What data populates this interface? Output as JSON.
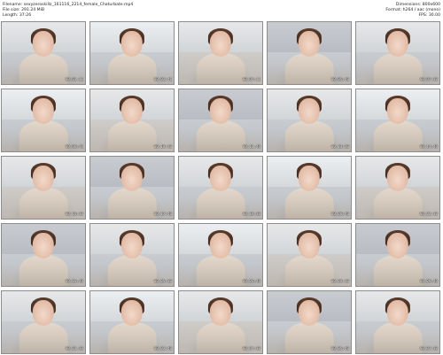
{
  "header": {
    "filename_label": "Filename:",
    "filename": "sexyzeroskillz_161116_2214_female_Chaturbate.mp4",
    "filesize_label": "File size:",
    "filesize": "291.24 MiB",
    "length_label": "Length:",
    "length": "37:26",
    "dimensions_label": "Dimensions:",
    "dimensions": "800x600",
    "format_label": "Format:",
    "format": "h264 / aac (mono)",
    "fps_label": "FPS:",
    "fps": "30.00"
  },
  "thumbnails": [
    {
      "timestamp": "00:01:11"
    },
    {
      "timestamp": "00:02:41"
    },
    {
      "timestamp": "00:04:11"
    },
    {
      "timestamp": "00:05:40"
    },
    {
      "timestamp": "00:07:10"
    },
    {
      "timestamp": "00:08:41"
    },
    {
      "timestamp": "00:10:10"
    },
    {
      "timestamp": "00:11:40"
    },
    {
      "timestamp": "00:13:10"
    },
    {
      "timestamp": "00:14:40"
    },
    {
      "timestamp": "00:16:10"
    },
    {
      "timestamp": "00:17:40"
    },
    {
      "timestamp": "00:19:10"
    },
    {
      "timestamp": "00:20:40"
    },
    {
      "timestamp": "00:22:10"
    },
    {
      "timestamp": "00:23:40"
    },
    {
      "timestamp": "00:25:10"
    },
    {
      "timestamp": "00:26:40"
    },
    {
      "timestamp": "00:28:10"
    },
    {
      "timestamp": "00:29:40"
    },
    {
      "timestamp": "00:31:10"
    },
    {
      "timestamp": "00:32:40"
    },
    {
      "timestamp": "00:34:10"
    },
    {
      "timestamp": "00:35:40"
    },
    {
      "timestamp": "00:37:10"
    }
  ]
}
